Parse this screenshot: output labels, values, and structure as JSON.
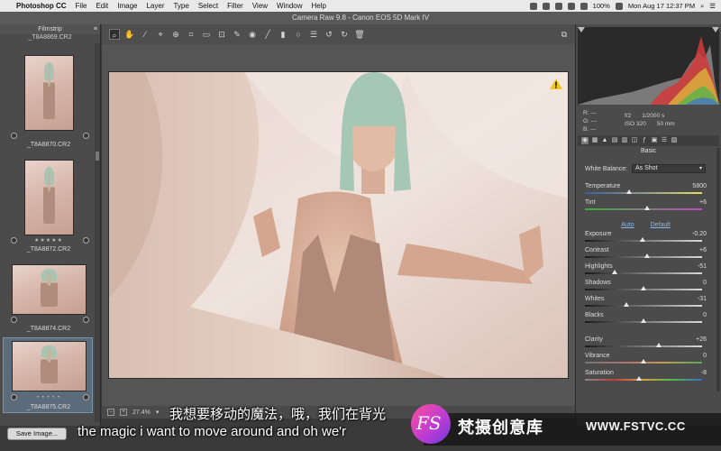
{
  "menubar": {
    "app": "Photoshop CC",
    "items": [
      "File",
      "Edit",
      "Image",
      "Layer",
      "Type",
      "Select",
      "Filter",
      "View",
      "Window",
      "Help"
    ],
    "battery": "100%",
    "datetime": "Mon Aug 17  12:37 PM"
  },
  "window": {
    "title": "Camera Raw 9.8  -  Canon EOS 5D Mark IV"
  },
  "filmstrip": {
    "title": "Filmstrip",
    "top_name": "_T8A8869.CR2",
    "items": [
      {
        "name": "_T8A8870.CR2",
        "stars": ""
      },
      {
        "name": "_T8A8872.CR2",
        "stars": "★★★★★"
      },
      {
        "name": "_T8A8874.CR2",
        "stars": ""
      },
      {
        "name": "_T8A8875.CR2",
        "stars": "• • • • •"
      }
    ],
    "save_label": "Save Image..."
  },
  "toolbar": {
    "icons": [
      "zoom-icon",
      "hand-icon",
      "white-balance-icon",
      "color-sampler-icon",
      "target-adjust-icon",
      "crop-icon",
      "straighten-icon",
      "transform-icon",
      "spot-removal-icon",
      "red-eye-icon",
      "adjustment-brush-icon",
      "graduated-filter-icon",
      "radial-filter-icon",
      "preferences-icon",
      "rotate-ccw-icon",
      "rotate-cw-icon",
      "trash-icon"
    ]
  },
  "status": {
    "zoom": "27.4%"
  },
  "readout": {
    "r": "R:   ---",
    "g": "G:   ---",
    "b": "B:   ---",
    "aperture": "f/2",
    "shutter": "1/2000 s",
    "iso": "ISO 320",
    "focal": "50 mm"
  },
  "panel": {
    "title": "Basic",
    "white_balance_label": "White Balance:",
    "white_balance_value": "As Shot",
    "auto": "Auto",
    "default": "Default",
    "sliders": [
      {
        "label": "Temperature",
        "value": "5800",
        "pos": 0.38,
        "kind": "temp"
      },
      {
        "label": "Tint",
        "value": "+6",
        "pos": 0.53,
        "kind": "tint"
      },
      {
        "label": "Exposure",
        "value": "-0.20",
        "pos": 0.49,
        "kind": "exp"
      },
      {
        "label": "Contrast",
        "value": "+6",
        "pos": 0.53,
        "kind": "exp"
      },
      {
        "label": "Highlights",
        "value": "-51",
        "pos": 0.25,
        "kind": "exp"
      },
      {
        "label": "Shadows",
        "value": "0",
        "pos": 0.5,
        "kind": "exp"
      },
      {
        "label": "Whites",
        "value": "-31",
        "pos": 0.35,
        "kind": "exp"
      },
      {
        "label": "Blacks",
        "value": "0",
        "pos": 0.5,
        "kind": "exp"
      },
      {
        "label": "Clarity",
        "value": "+26",
        "pos": 0.63,
        "kind": "exp"
      },
      {
        "label": "Vibrance",
        "value": "0",
        "pos": 0.5,
        "kind": "vib"
      },
      {
        "label": "Saturation",
        "value": "-8",
        "pos": 0.46,
        "kind": "sat"
      }
    ]
  },
  "subtitles": {
    "cn": "我想要移动的魔法，哦，我们在背光",
    "en": "the magic i want to move around and oh we'r"
  },
  "watermark": {
    "logo": "FS",
    "name_cn": "梵摄创意库",
    "url": "WWW.FSTVC.CC"
  }
}
